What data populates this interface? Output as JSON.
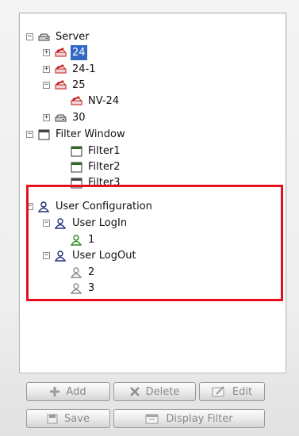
{
  "tree": {
    "server": "Server",
    "device_24": "24",
    "device_24_1": "24-1",
    "device_25": "25",
    "device_nv_24": "NV-24",
    "device_30": "30",
    "filter_window": "Filter Window",
    "filter1": "Filter1",
    "filter2": "Filter2",
    "filter3": "Filter3",
    "user_configuration": "User Configuration",
    "user_login": "User LogIn",
    "user_1": "1",
    "user_logout": "User LogOut",
    "user_2": "2",
    "user_3": "3"
  },
  "buttons": {
    "add": "Add",
    "delete": "Delete",
    "edit": "Edit",
    "save": "Save",
    "display_filter": "Display Filter"
  },
  "colors": {
    "highlight": "#e60f1e",
    "selection": "#316ac5"
  }
}
